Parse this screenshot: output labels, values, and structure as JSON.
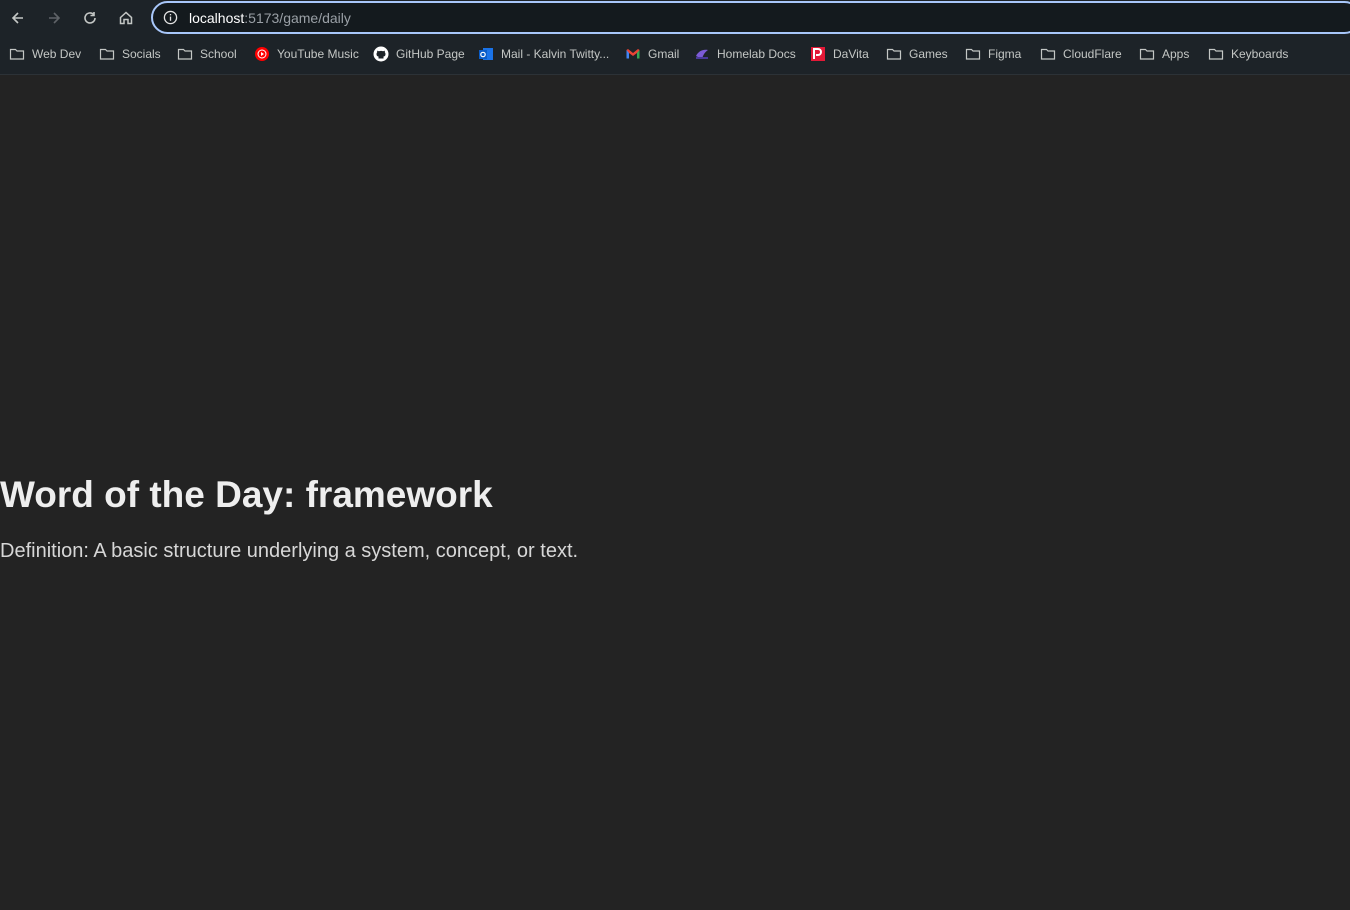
{
  "browser": {
    "url_host": "localhost",
    "url_path": ":5173/game/daily",
    "bookmarks": [
      {
        "label": "Web Dev",
        "icon": "folder-icon"
      },
      {
        "label": "Socials",
        "icon": "folder-icon"
      },
      {
        "label": "School",
        "icon": "folder-icon"
      },
      {
        "label": "YouTube Music",
        "icon": "youtube-music-icon"
      },
      {
        "label": "GitHub Page",
        "icon": "github-icon"
      },
      {
        "label": "Mail - Kalvin Twitty...",
        "icon": "outlook-icon"
      },
      {
        "label": "Gmail",
        "icon": "gmail-icon"
      },
      {
        "label": "Homelab Docs",
        "icon": "homelab-icon"
      },
      {
        "label": "DaVita",
        "icon": "davita-icon"
      },
      {
        "label": "Games",
        "icon": "folder-icon"
      },
      {
        "label": "Figma",
        "icon": "folder-icon"
      },
      {
        "label": "CloudFlare",
        "icon": "folder-icon"
      },
      {
        "label": "Apps",
        "icon": "folder-icon"
      },
      {
        "label": "Keyboards",
        "icon": "folder-icon"
      }
    ]
  },
  "page": {
    "title": "Word of the Day: framework",
    "definition": "Definition: A basic structure underlying a system, concept, or text."
  },
  "colors": {
    "background": "#232323",
    "toolbar": "#1d2328",
    "omnibox_border": "#a8c7fa"
  }
}
